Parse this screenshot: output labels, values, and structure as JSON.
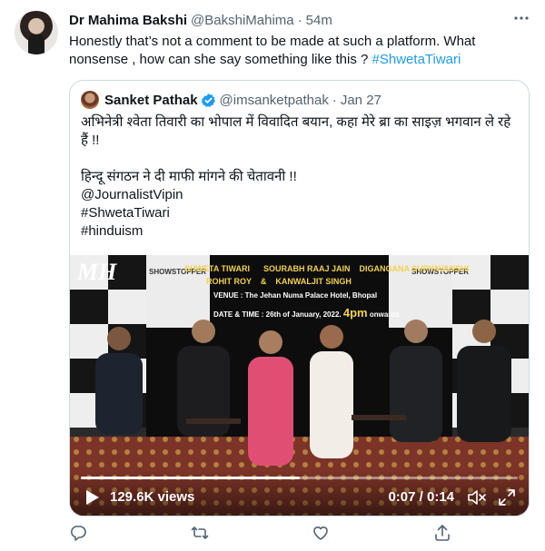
{
  "tweet": {
    "author_name": "Dr Mahima Bakshi",
    "author_handle": "@BakshiMahima",
    "separator": "·",
    "time": "54m",
    "text_before": "Honestly that’s not a comment to be made at such a platform. What nonsense , how can she say something like this ? ",
    "hashtag": "#ShwetaTiwari"
  },
  "quote": {
    "author_name": "Sanket Pathak",
    "author_handle": "@imsanketpathak",
    "separator": "·",
    "date": "Jan 27",
    "lines": [
      "अभिनेत्री श्वेता तिवारी का भोपाल में विवादित बयान, कहा मेरे ब्रा का साइज़ भगवान ले रहे हैं !!",
      "हिन्दू संगठन ने दी माफी मांगने की चेतावनी !!",
      "@JournalistVipin",
      "#ShwetaTiwari",
      "#hinduism"
    ]
  },
  "video": {
    "poster_text": {
      "names_row1": "SHWETA TIWARI      SOURABH RAAJ JAIN    DIGANGANA SURYAVANSHI",
      "names_row2": "ROHIT ROY    &    KANWALJIT SINGH",
      "venue": "VENUE : The Jehan Numa Palace Hotel, Bhopal",
      "date_time": "DATE & TIME : 26th of January, 2022.",
      "time_big": "4pm",
      "time_suffix": "onwards",
      "logo": "MH",
      "brand": "SHOWSTOPPER",
      "brand_small": "SHOWSTOPPER"
    },
    "views": "129.6K views",
    "time": "0:07 / 0:14",
    "progress": 0.5
  },
  "icons": {
    "more": "more-icon",
    "verified": "verified-badge-icon",
    "play": "play-icon",
    "volume": "mute-icon",
    "fullscreen": "fullscreen-icon",
    "reply": "reply-icon",
    "retweet": "retweet-icon",
    "like": "like-icon",
    "share": "share-icon"
  },
  "colors": {
    "accent": "#1d9bf0",
    "muted": "#536471",
    "border": "#cfd9de",
    "verified": "#1d9bf0"
  }
}
